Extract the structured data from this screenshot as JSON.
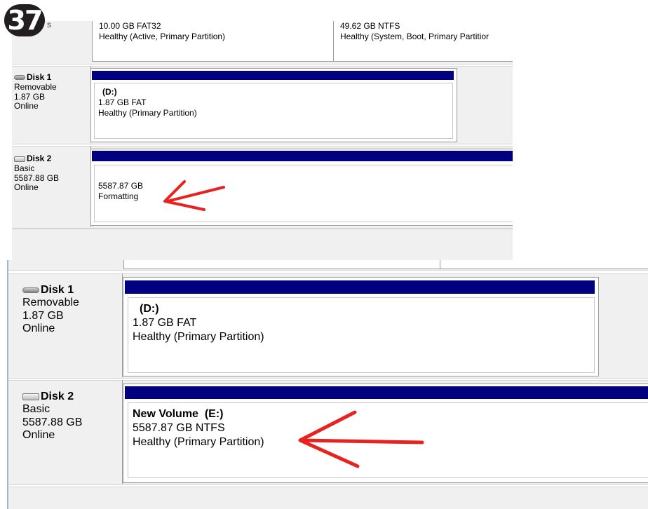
{
  "step_badge": "37",
  "top": {
    "partial_volumes": [
      {
        "size": "10.00 GB FAT32",
        "status": "Healthy (Active, Primary Partition)"
      },
      {
        "size": "49.62 GB NTFS",
        "status": "Healthy (System, Boot, Primary Partitior"
      }
    ],
    "partial_disk_suffix": "s",
    "disk1": {
      "name": "Disk 1",
      "type": "Removable",
      "size": "1.87 GB",
      "state": "Online",
      "icon": "removable-disk-icon",
      "volume": {
        "title": "(D:)",
        "size": "1.87 GB FAT",
        "status": "Healthy (Primary Partition)"
      }
    },
    "disk2": {
      "name": "Disk 2",
      "type": "Basic",
      "size": "5587.88 GB",
      "state": "Online",
      "icon": "basic-disk-icon",
      "volume": {
        "size": "5587.87 GB",
        "status": "Formatting"
      }
    }
  },
  "bottom": {
    "disk1": {
      "name": "Disk 1",
      "type": "Removable",
      "size": "1.87 GB",
      "state": "Online",
      "icon": "removable-disk-icon",
      "volume": {
        "title": "(D:)",
        "size": "1.87 GB FAT",
        "status": "Healthy (Primary Partition)"
      }
    },
    "disk2": {
      "name": "Disk 2",
      "type": "Basic",
      "size": "5587.88 GB",
      "state": "Online",
      "icon": "basic-disk-icon",
      "volume": {
        "title": "New Volume  (E:)",
        "size": "5587.87 GB NTFS",
        "status": "Healthy (Primary Partition)"
      }
    }
  },
  "colors": {
    "volume_bar": "#000080",
    "annotation_arrow": "#e8221f",
    "badge": "#231f20"
  }
}
